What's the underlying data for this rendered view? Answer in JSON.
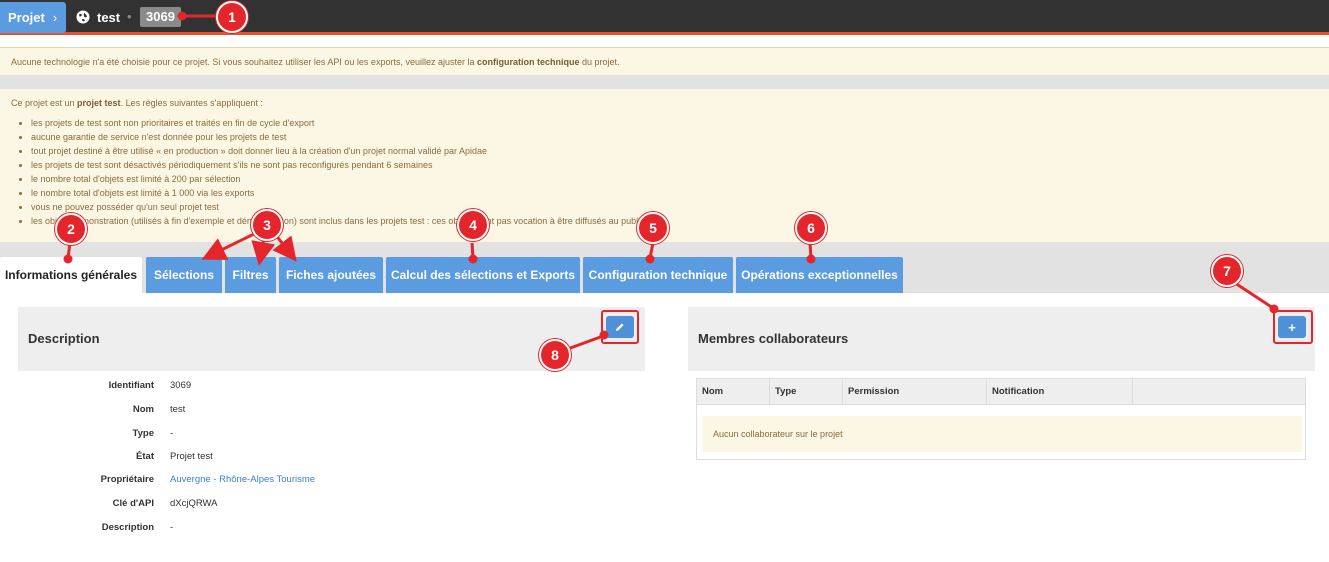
{
  "topbar": {
    "project_button": "Projet",
    "chevron": "›",
    "project_name": "test",
    "separator": "•",
    "project_id": "3069"
  },
  "alerts": {
    "tech_before": "Aucune technologie n'a été choisie pour ce projet. Si vous souhaitez utiliser les API ou les exports, veuillez ajuster la ",
    "tech_bold": "configuration technique",
    "tech_after": " du projet.",
    "test_before": "Ce projet est un ",
    "test_bold": "projet test",
    "test_after": ". Les règles suivantes s'appliquent :",
    "rules": [
      "les projets de test sont non prioritaires et traités en fin de cycle d'export",
      "aucune garantie de service n'est donnée pour les projets de test",
      "tout projet destiné à être utilisé « en production » doit donner lieu à la création d'un projet normal validé par Apidae",
      "les projets de test sont désactivés périodiquement s'ils ne sont pas reconfigurés pendant 6 semaines",
      "le nombre total d'objets est limité à 200 par sélection",
      "le nombre total d'objets est limité à 1 000 via les exports",
      "vous ne pouvez posséder qu'un seul projet test",
      "les objets démonstration (utilisés à fin d'exemple et démonstration) sont inclus dans les projets test : ces objets n'ont pas vocation à être diffusés au public"
    ]
  },
  "tabs": [
    "Informations générales",
    "Sélections",
    "Filtres",
    "Fiches ajoutées",
    "Calcul des sélections et Exports",
    "Configuration technique",
    "Opérations exceptionnelles"
  ],
  "description": {
    "title": "Description",
    "edit_icon": "pencil-icon",
    "fields": [
      {
        "label": "Identifiant",
        "value": "3069"
      },
      {
        "label": "Nom",
        "value": "test"
      },
      {
        "label": "Type",
        "value": "-"
      },
      {
        "label": "État",
        "value": "Projet test"
      },
      {
        "label": "Propriétaire",
        "value": "Auvergne - Rhône-Alpes Tourisme"
      },
      {
        "label": "Clé d'API",
        "value": "dXcjQRWA"
      },
      {
        "label": "Description",
        "value": "-"
      }
    ]
  },
  "members": {
    "title": "Membres collaborateurs",
    "add_label": "+",
    "columns": [
      "Nom",
      "Type",
      "Permission",
      "Notification"
    ],
    "empty_message": "Aucun collaborateur sur le projet"
  },
  "annotations": [
    "1",
    "2",
    "3",
    "4",
    "5",
    "6",
    "7",
    "8"
  ],
  "colors": {
    "accent": "#5b9be0",
    "topbar": "#323232",
    "annotation": "#e4252c",
    "alert_bg": "#fcf6e4"
  }
}
